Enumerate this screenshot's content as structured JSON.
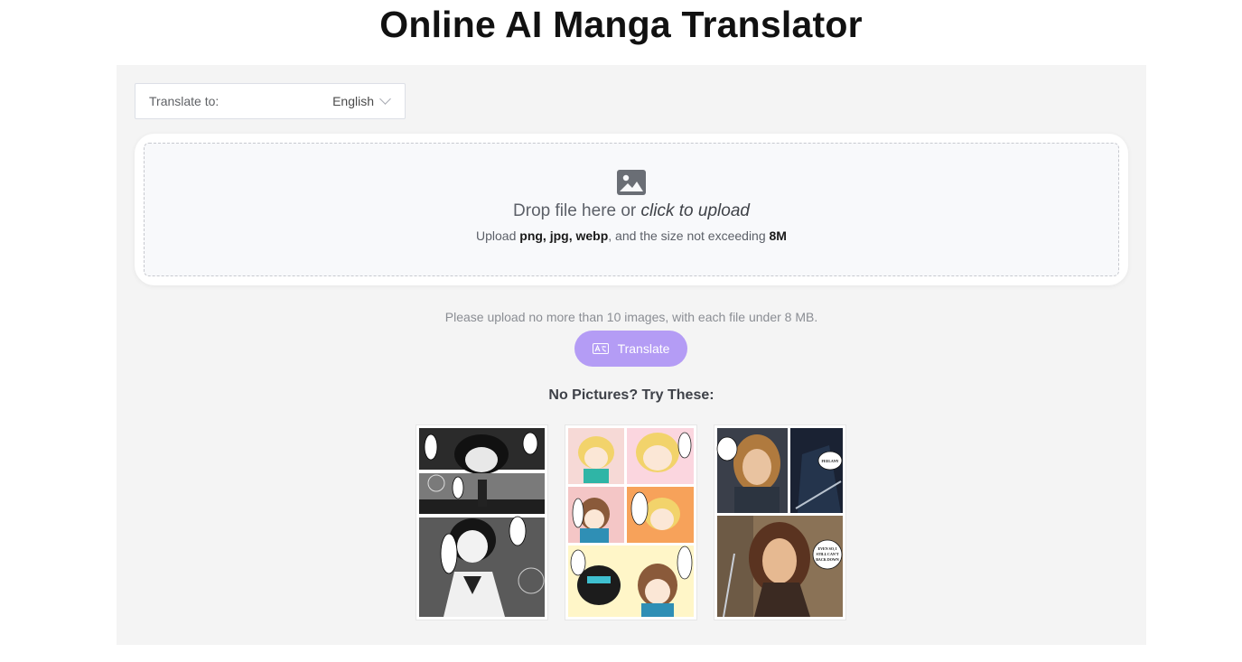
{
  "page": {
    "title": "Online AI Manga Translator"
  },
  "language_select": {
    "label": "Translate to:",
    "value": "English"
  },
  "upload": {
    "drop_prefix": "Drop file here or ",
    "drop_link": "click to upload",
    "hint_prefix": "Upload ",
    "formats": "png, jpg, webp",
    "hint_middle": ", and the size not exceeding ",
    "max_size": "8M"
  },
  "limit_note": "Please upload no more than 10 images, with each file under 8 MB.",
  "translate_button": {
    "label": "Translate",
    "color": "#b49cf5"
  },
  "samples": {
    "heading": "No Pictures? Try These:",
    "items": [
      {
        "icon": "manga-sample-bw-icon"
      },
      {
        "icon": "manga-sample-color-icon"
      },
      {
        "icon": "manga-sample-comic-icon",
        "bubble_text": [
          "FEELANY",
          "EVEN SO, I",
          "STILL CAN'T",
          "BACK DOWN"
        ]
      }
    ]
  },
  "colors": {
    "panel_bg": "#f4f4f4",
    "accent": "#b49cf5"
  }
}
